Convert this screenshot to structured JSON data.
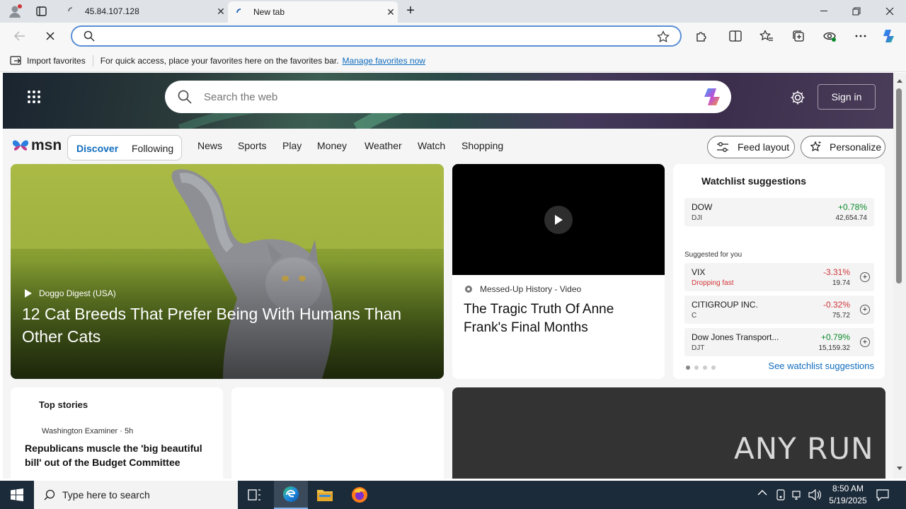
{
  "browser": {
    "tabs": [
      {
        "title": "45.84.107.128"
      },
      {
        "title": "New tab"
      }
    ],
    "address": {
      "value": "",
      "placeholder": ""
    }
  },
  "favorites_bar": {
    "import_label": "Import favorites",
    "message": "For quick access, place your favorites here on the favorites bar.",
    "manage_link": "Manage favorites now"
  },
  "msn": {
    "search_placeholder": "Search the web",
    "signin": "Sign in",
    "logo": "msn",
    "tabs": [
      "Discover",
      "Following"
    ],
    "nav": [
      "News",
      "Sports",
      "Play",
      "Money",
      "Weather",
      "Watch",
      "Shopping"
    ],
    "feed_layout": "Feed layout",
    "personalize": "Personalize"
  },
  "hero": {
    "source": "Doggo Digest (USA)",
    "headline": "12 Cat Breeds That Prefer Being With Humans Than Other Cats"
  },
  "video": {
    "source": "Messed-Up History - Video",
    "headline": "The Tragic Truth Of Anne Frank's Final Months"
  },
  "watchlist": {
    "title": "Watchlist suggestions",
    "suggested_label": "Suggested for you",
    "see_more": "See watchlist suggestions",
    "top": {
      "name": "DOW",
      "symbol": "DJI",
      "change": "+0.78%",
      "price": "42,654.74"
    },
    "items": [
      {
        "name": "VIX",
        "symbol": "Dropping fast",
        "change": "-3.31%",
        "price": "19.74"
      },
      {
        "name": "CITIGROUP INC.",
        "symbol": "C",
        "change": "-0.32%",
        "price": "75.72"
      },
      {
        "name": "Dow Jones Transport...",
        "symbol": "DJT",
        "change": "+0.79%",
        "price": "15,159.32"
      }
    ]
  },
  "top_stories": {
    "title": "Top stories",
    "source": "Washington Examiner · 5h",
    "headline": "Republicans muscle the 'big beautiful bill' out of the Budget Committee"
  },
  "watermark": "ANY RUN",
  "taskbar": {
    "search_placeholder": "Type here to search",
    "time": "8:50 AM",
    "date": "5/19/2025"
  },
  "colors": {
    "accent": "#0f6cbd",
    "positive": "#0a8a2a",
    "negative": "#d13438"
  }
}
